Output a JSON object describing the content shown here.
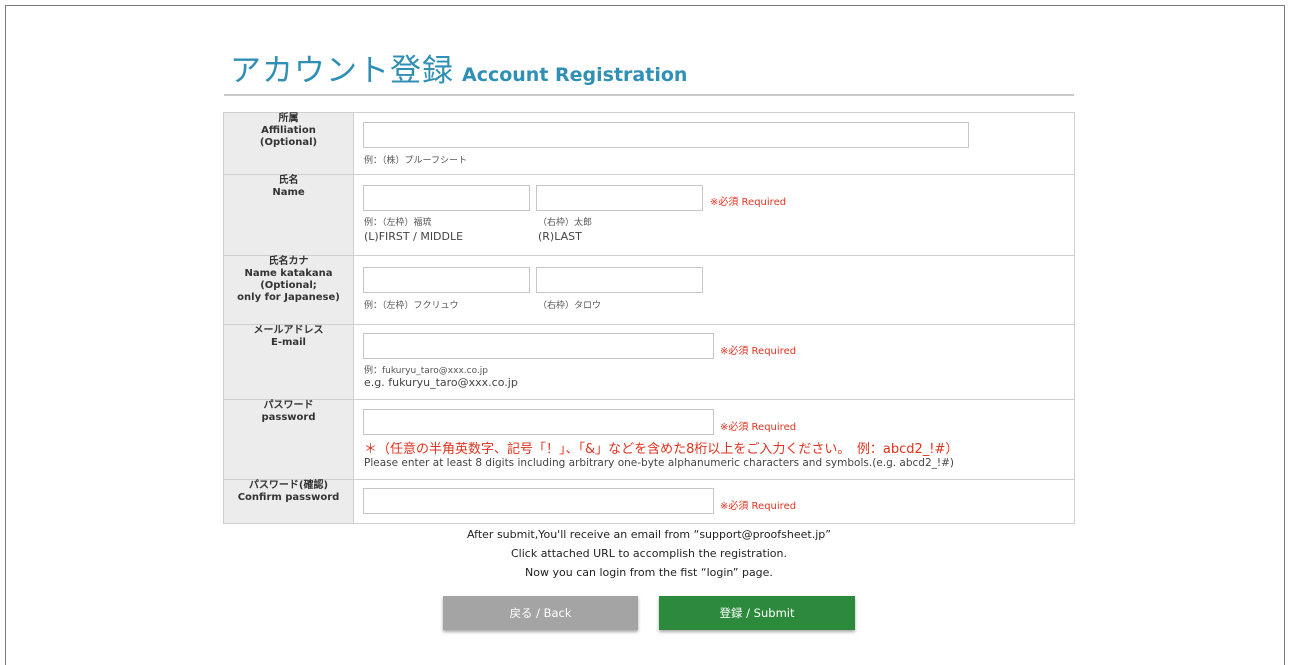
{
  "header": {
    "title_jp": "アカウント登録",
    "title_en": "Account Registration"
  },
  "required_label": "※必須 Required",
  "fields": {
    "affiliation": {
      "label_jp": "所属",
      "label_en": "Affiliation",
      "label_note": "(Optional)",
      "hint": "例：（株）プルーフシート",
      "value": ""
    },
    "name": {
      "label_jp": "氏名",
      "label_en": "Name",
      "left_hint": "例：（左枠）福琉",
      "left_hint_en": "(L)FIRST / MIDDLE",
      "right_hint": "（右枠）太郎",
      "right_hint_en": "(R)LAST",
      "left_value": "",
      "right_value": ""
    },
    "katakana": {
      "label_jp": "氏名カナ",
      "label_en": "Name katakana",
      "label_note1": "(Optional;",
      "label_note2": "only for Japanese)",
      "left_hint": "例：（左枠）フクリュウ",
      "right_hint": "（右枠）タロウ",
      "left_value": "",
      "right_value": ""
    },
    "email": {
      "label_jp": "メールアドレス",
      "label_en": "E-mail",
      "hint": "例：fukuryu_taro@xxx.co.jp",
      "hint_en": "e.g. fukuryu_taro@xxx.co.jp",
      "value": ""
    },
    "password": {
      "label_jp": "パスワード",
      "label_en": "password",
      "note_jp": "＊（任意の半角英数字、記号「！」、「&」などを含めた8桁以上をご入力ください。　例：abcd2_!#）",
      "note_en": "Please enter at least 8 digits including arbitrary one-byte alphanumeric characters and symbols.(e.g.   abcd2_!#)",
      "value": ""
    },
    "confirm": {
      "label_jp": "パスワード(確認)",
      "label_en": "Confirm password",
      "value": ""
    }
  },
  "notes": [
    "After submit,You'll receive an email from “support@proofsheet.jp”",
    "Click attached URL to accomplish the registration.",
    "Now you can login from the fist “login” page."
  ],
  "buttons": {
    "back": "戻る / Back",
    "submit": "登録 / Submit"
  },
  "colors": {
    "accent": "#2f8fb4",
    "required": "#e0321e",
    "submit": "#2c8a3c",
    "back": "#a4a4a4",
    "label_bg": "#ececec"
  }
}
